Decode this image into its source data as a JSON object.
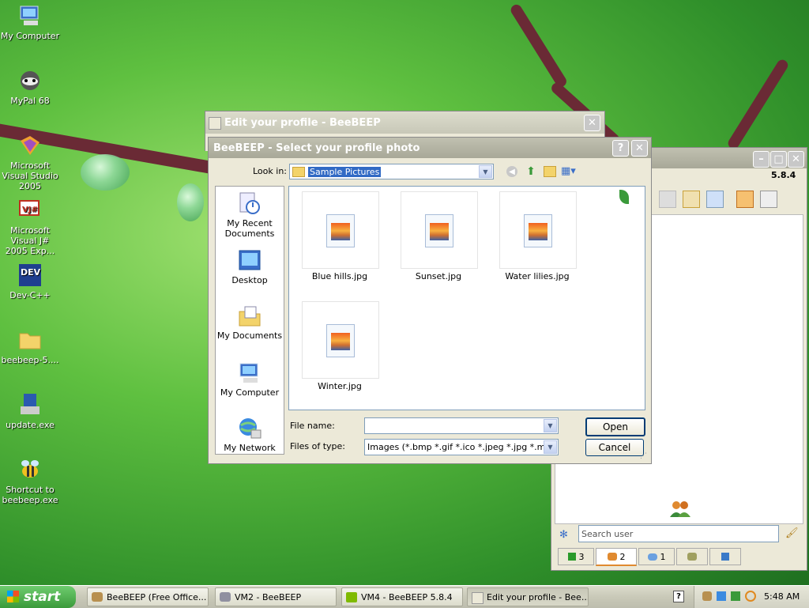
{
  "desktop": {
    "icons": [
      {
        "label": "My Computer",
        "icon": "my-computer-icon"
      },
      {
        "label": "MyPal 68",
        "icon": "mypal-icon"
      },
      {
        "label": "Microsoft Visual Studio 2005",
        "icon": "visual-studio-icon"
      },
      {
        "label": "Microsoft Visual J# 2005 Exp...",
        "icon": "visual-jsharp-icon"
      },
      {
        "label": "Dev-C++",
        "icon": "devcpp-icon"
      },
      {
        "label": "beebeep-5....",
        "icon": "folder-icon"
      },
      {
        "label": "update.exe",
        "icon": "installer-icon"
      },
      {
        "label": "Shortcut to beebeep.exe",
        "icon": "bee-icon"
      }
    ]
  },
  "edit_profile_window": {
    "title": "Edit your profile - BeeBEEP"
  },
  "beebeep_main": {
    "version": "5.8.4",
    "search_placeholder": "Search user",
    "tabs": [
      {
        "label": "3",
        "icon": "chat-book-icon"
      },
      {
        "label": "2",
        "icon": "users-icon"
      },
      {
        "label": "1",
        "icon": "messages-icon"
      },
      {
        "label": "",
        "icon": "groups-icon"
      },
      {
        "label": "",
        "icon": "share-icon"
      }
    ]
  },
  "dialog": {
    "title": "BeeBEEP - Select your profile photo",
    "look_in_label": "Look in:",
    "look_in_value": "Sample Pictures",
    "places": [
      {
        "label": "My Recent Documents",
        "icon": "recent-documents-icon"
      },
      {
        "label": "Desktop",
        "icon": "desktop-icon"
      },
      {
        "label": "My Documents",
        "icon": "my-documents-icon"
      },
      {
        "label": "My Computer",
        "icon": "my-computer-icon"
      },
      {
        "label": "My Network",
        "icon": "my-network-icon"
      }
    ],
    "files": [
      "Blue hills.jpg",
      "Sunset.jpg",
      "Water lilies.jpg",
      "Winter.jpg"
    ],
    "file_name_label": "File name:",
    "file_name_value": "",
    "files_of_type_label": "Files of type:",
    "files_of_type_value": "Images (*.bmp *.gif *.ico *.jpeg *.jpg *.mng *.pbm",
    "open_label": "Open",
    "cancel_label": "Cancel"
  },
  "taskbar": {
    "start_label": "start",
    "tasks": [
      {
        "label": "BeeBEEP (Free Office..."
      },
      {
        "label": "VM2 - BeeBEEP"
      },
      {
        "label": "VM4 - BeeBEEP 5.8.4"
      },
      {
        "label": "Edit your profile - Bee..."
      }
    ],
    "clock": "5:48 AM"
  },
  "colors": {
    "xp_blue_button_border": "#003c74",
    "desktop_green": "#5fc040",
    "start_green": "#3a9a3a"
  }
}
